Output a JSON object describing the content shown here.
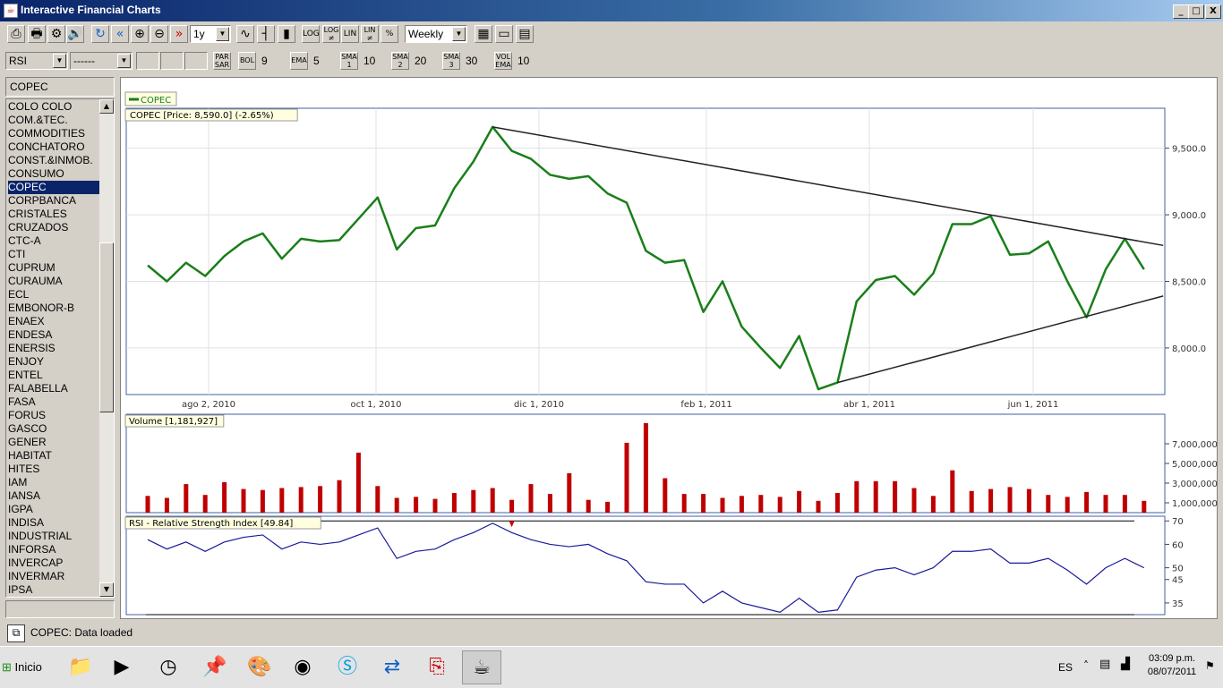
{
  "window": {
    "title": "Interactive Financial Charts",
    "min": "_",
    "max": "□",
    "close": "X"
  },
  "toolbar1": {
    "period": "1y",
    "interval": "Weekly",
    "buttons": [
      "LOG",
      "LOG ≠",
      "LIN",
      "LIN ≠",
      "%"
    ]
  },
  "toolbar2": {
    "indicator": "RSI",
    "indicator2": "------",
    "par_sar": "PAR SAR",
    "bol": "BOL",
    "bol_val": "9",
    "ema": "EMA",
    "ema_val": "5",
    "sma1": "SMA 1",
    "sma1_val": "10",
    "sma2": "SMA 2",
    "sma2_val": "20",
    "sma3": "SMA 3",
    "sma3_val": "30",
    "volema": "VOL EMA",
    "volema_val": "10"
  },
  "left": {
    "symbol": "COPEC",
    "selected": "COPEC",
    "items": [
      "COLO COLO",
      "COM.&TEC.",
      "COMMODITIES",
      "CONCHATORO",
      "CONST.&INMOB.",
      "CONSUMO",
      "COPEC",
      "CORPBANCA",
      "CRISTALES",
      "CRUZADOS",
      "CTC-A",
      "CTI",
      "CUPRUM",
      "CURAUMA",
      "ECL",
      "EMBONOR-B",
      "ENAEX",
      "ENDESA",
      "ENERSIS",
      "ENJOY",
      "ENTEL",
      "FALABELLA",
      "FASA",
      "FORUS",
      "GASCO",
      "GENER",
      "HABITAT",
      "HITES",
      "IAM",
      "IANSA",
      "IGPA",
      "INDISA",
      "INDUSTRIAL",
      "INFORSA",
      "INVERCAP",
      "INVERMAR",
      "IPSA"
    ]
  },
  "legend": {
    "series": "COPEC"
  },
  "chart_data": [
    {
      "type": "line",
      "title": "COPEC [Price: 8,590.0] (-2.65%)",
      "series": [
        {
          "name": "COPEC",
          "values": [
            8620,
            8500,
            8640,
            8540,
            8690,
            8800,
            8860,
            8670,
            8820,
            8800,
            8810,
            8970,
            9130,
            8740,
            8900,
            8920,
            9200,
            9400,
            9660,
            9480,
            9420,
            9300,
            9270,
            9290,
            9160,
            9090,
            8730,
            8640,
            8660,
            8270,
            8500,
            8160,
            8000,
            7850,
            8090,
            7690,
            7740,
            8350,
            8510,
            8540,
            8400,
            8560,
            8930,
            8930,
            8990,
            8700,
            8710,
            8800,
            8500,
            8230,
            8590,
            8820,
            8590
          ]
        }
      ],
      "xticks": [
        "ago 2, 2010",
        "oct 1, 2010",
        "dic 1, 2010",
        "feb 1, 2011",
        "abr 1, 2011",
        "jun 1, 2011"
      ],
      "yticks": [
        "8,000.0",
        "8,500.0",
        "9,000.0",
        "9,500.0"
      ],
      "ylim": [
        7650,
        9800
      ],
      "trendlines": [
        {
          "from": [
            18,
            9660
          ],
          "to": [
            53,
            8770
          ]
        },
        {
          "from": [
            36,
            7740
          ],
          "to": [
            53,
            8390
          ]
        }
      ]
    },
    {
      "type": "bar",
      "title": "Volume [1,181,927]",
      "values": [
        1700000,
        1500000,
        2900000,
        1800000,
        3100000,
        2400000,
        2300000,
        2500000,
        2600000,
        2700000,
        3300000,
        6100000,
        2700000,
        1500000,
        1600000,
        1400000,
        2000000,
        2300000,
        2500000,
        1300000,
        2900000,
        1900000,
        4000000,
        1300000,
        1100000,
        7100000,
        9100000,
        3500000,
        1900000,
        1900000,
        1500000,
        1700000,
        1800000,
        1600000,
        2200000,
        1200000,
        2000000,
        3200000,
        3200000,
        3200000,
        2500000,
        1700000,
        4300000,
        2200000,
        2400000,
        2600000,
        2400000,
        1800000,
        1600000,
        2100000,
        1800000,
        1800000,
        1200000
      ],
      "yticks": [
        "1,000,000",
        "3,000,000",
        "5,000,000",
        "7,000,000"
      ],
      "ylim": [
        0,
        10000000
      ]
    },
    {
      "type": "line",
      "title": "RSI - Relative Strength Index [49.84]",
      "series": [
        {
          "name": "RSI",
          "values": [
            62,
            58,
            61,
            57,
            61,
            63,
            64,
            58,
            61,
            60,
            61,
            64,
            67,
            54,
            57,
            58,
            62,
            65,
            69,
            65,
            62,
            60,
            59,
            60,
            56,
            53,
            44,
            43,
            43,
            35,
            40,
            35,
            33,
            31,
            37,
            31,
            32,
            46,
            49,
            50,
            47,
            50,
            57,
            57,
            58,
            52,
            52,
            54,
            49,
            43,
            50,
            54,
            50
          ]
        }
      ],
      "yticks": [
        "35",
        "45",
        "50",
        "60",
        "70"
      ],
      "ylim": [
        30,
        72
      ],
      "levels": [
        70,
        30
      ]
    }
  ],
  "status": {
    "text": "COPEC: Data loaded"
  },
  "taskbar": {
    "start": "Inicio",
    "lang": "ES",
    "time": "03:09 p.m.",
    "date": "08/07/2011"
  }
}
